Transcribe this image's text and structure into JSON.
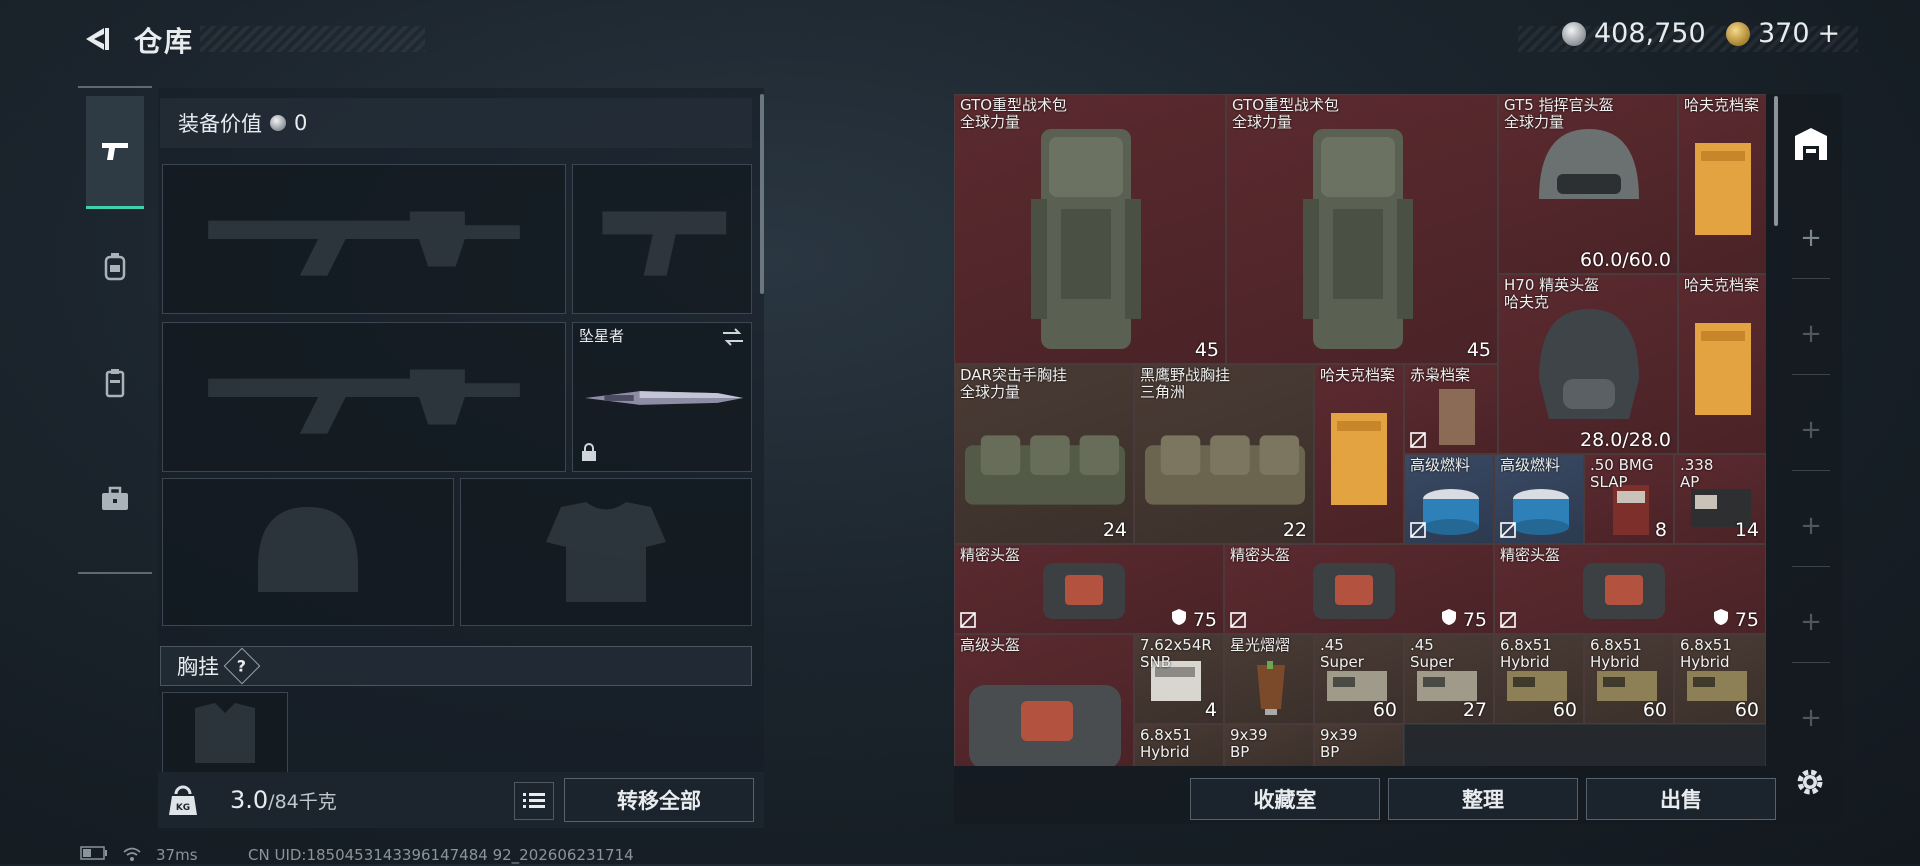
{
  "header": {
    "title": "仓库",
    "currency_silver": "408,750",
    "currency_gold": "370",
    "currency_gold_plus": "+"
  },
  "equipment": {
    "value_label": "装备价值",
    "value": "0",
    "melee_name": "坠星者",
    "chest_label": "胸挂",
    "chest_help": "?",
    "weight_value": "3.0",
    "weight_max": "/84千克",
    "transfer_all": "转移全部"
  },
  "inventory": {
    "items": [
      {
        "name": "GTO重型战术包\n全球力量",
        "count": "45"
      },
      {
        "name": "GTO重型战术包\n全球力量",
        "count": "45"
      },
      {
        "name": "GT5 指挥官头盔\n全球力量",
        "count": "60.0/60.0"
      },
      {
        "name": "哈夫克档案",
        "count": ""
      },
      {
        "name": "H70 精英头盔\n哈夫克",
        "count": "28.0/28.0"
      },
      {
        "name": "哈夫克档案",
        "count": ""
      },
      {
        "name": "DAR突击手胸挂\n全球力量",
        "count": "24"
      },
      {
        "name": "黑鹰野战胸挂\n三角洲",
        "count": "22"
      },
      {
        "name": "哈夫克档案",
        "count": ""
      },
      {
        "name": "赤枭档案",
        "count": ""
      },
      {
        "name": "高级燃料",
        "count": ""
      },
      {
        "name": "高级燃料",
        "count": ""
      },
      {
        "name": ".50 BMG\nSLAP",
        "count": "8"
      },
      {
        "name": ".338\nAP",
        "count": "14"
      },
      {
        "name": "精密头盔",
        "count": "75"
      },
      {
        "name": "精密头盔",
        "count": "75"
      },
      {
        "name": "精密头盔",
        "count": "75"
      },
      {
        "name": "高级头盔",
        "count": ""
      },
      {
        "name": "7.62x54R\nSNB",
        "count": "4"
      },
      {
        "name": "星光熠熠",
        "count": ""
      },
      {
        "name": ".45\nSuper",
        "count": "60"
      },
      {
        "name": ".45\nSuper",
        "count": "27"
      },
      {
        "name": "6.8x51\nHybrid",
        "count": "60"
      },
      {
        "name": "6.8x51\nHybrid",
        "count": "60"
      },
      {
        "name": "6.8x51\nHybrid",
        "count": "60"
      },
      {
        "name": "6.8x51\nHybrid",
        "count": ""
      },
      {
        "name": "9x39\nBP",
        "count": ""
      },
      {
        "name": "9x39\nBP",
        "count": ""
      }
    ],
    "buttons": {
      "collection": "收藏室",
      "sort": "整理",
      "sell": "出售"
    }
  },
  "status": {
    "ping": "37ms",
    "uid": "CN UID:1850453143396147484 92_202606231714"
  },
  "colors": {
    "accent_green": "#3fd1a9",
    "cell_red": "#5b2a2f",
    "cell_brown": "#4a3b34",
    "cell_blue": "#3a4a63"
  }
}
